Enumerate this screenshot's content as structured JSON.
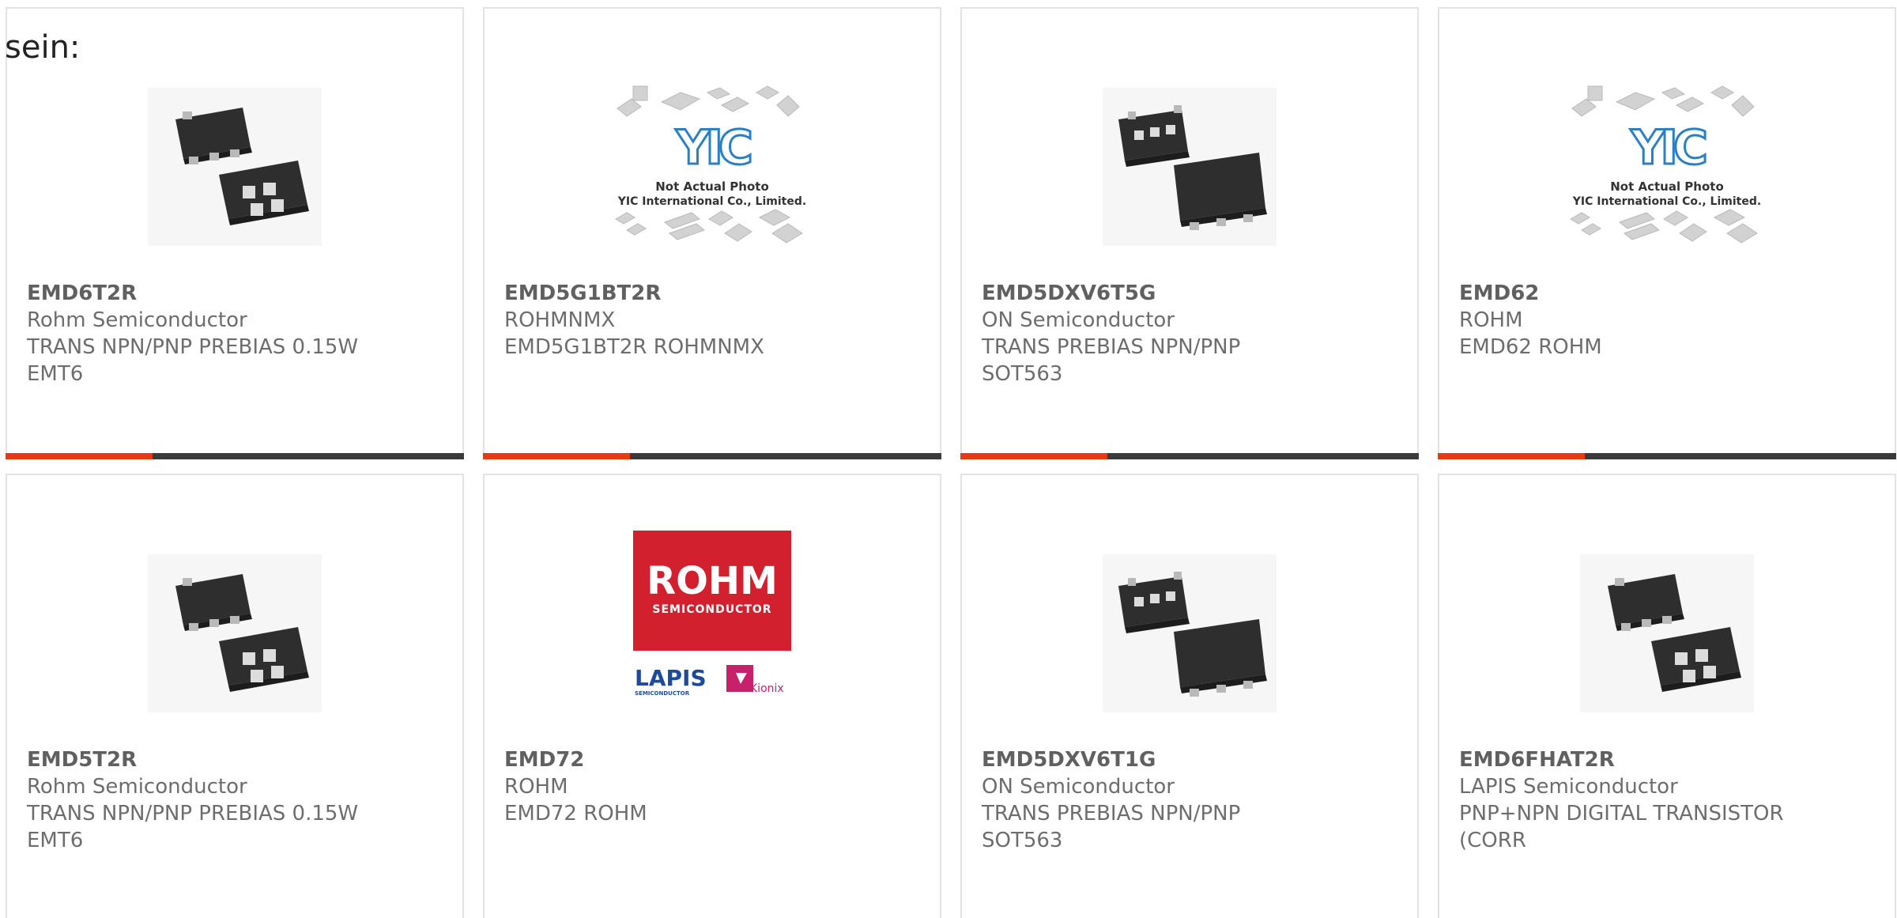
{
  "lead_text": "sein:",
  "colors": {
    "accent": "#e83a12",
    "bar_track": "#3a3a3a",
    "card_border": "#e3e3e3",
    "text": "#6d6d6d"
  },
  "cards": [
    {
      "part_number": "EMD6T2R",
      "manufacturer": "Rohm Semiconductor",
      "description_line1": "TRANS NPN/PNP PREBIAS 0.15W",
      "description_line2": "EMT6",
      "image": "chip-package-emt6",
      "progress": 0.32
    },
    {
      "part_number": "EMD5G1BT2R",
      "manufacturer": "ROHMNMX",
      "description_line1": "EMD5G1BT2R ROHMNMX",
      "description_line2": "",
      "image": "yic-not-actual-photo",
      "image_text_1": "Not Actual Photo",
      "image_text_2": "YIC International Co., Limited.",
      "progress": 0.32
    },
    {
      "part_number": "EMD5DXV6T5G",
      "manufacturer": "ON Semiconductor",
      "description_line1": "TRANS PREBIAS NPN/PNP",
      "description_line2": "SOT563",
      "image": "chip-package-sot563",
      "progress": 0.32
    },
    {
      "part_number": "EMD62",
      "manufacturer": "ROHM",
      "description_line1": "EMD62 ROHM",
      "description_line2": "",
      "image": "yic-not-actual-photo",
      "image_text_1": "Not Actual Photo",
      "image_text_2": "YIC International Co., Limited.",
      "progress": 0.32
    },
    {
      "part_number": "EMD5T2R",
      "manufacturer": "Rohm Semiconductor",
      "description_line1": "TRANS NPN/PNP PREBIAS 0.15W",
      "description_line2": "EMT6",
      "image": "chip-package-emt6"
    },
    {
      "part_number": "EMD72",
      "manufacturer": "ROHM",
      "description_line1": "EMD72 ROHM",
      "description_line2": "",
      "image": "rohm-logo",
      "image_text_1": "ROHM",
      "image_text_2": "SEMICONDUCTOR",
      "image_text_3": "LAPIS",
      "image_text_4": "SEMICONDUCTOR",
      "image_text_5": "Kionix"
    },
    {
      "part_number": "EMD5DXV6T1G",
      "manufacturer": "ON Semiconductor",
      "description_line1": "TRANS PREBIAS NPN/PNP",
      "description_line2": "SOT563",
      "image": "chip-package-sot563"
    },
    {
      "part_number": "EMD6FHAT2R",
      "manufacturer": "LAPIS Semiconductor",
      "description_line1": "PNP+NPN DIGITAL TRANSISTOR",
      "description_line2": "(CORR",
      "image": "chip-package-emt6"
    }
  ]
}
